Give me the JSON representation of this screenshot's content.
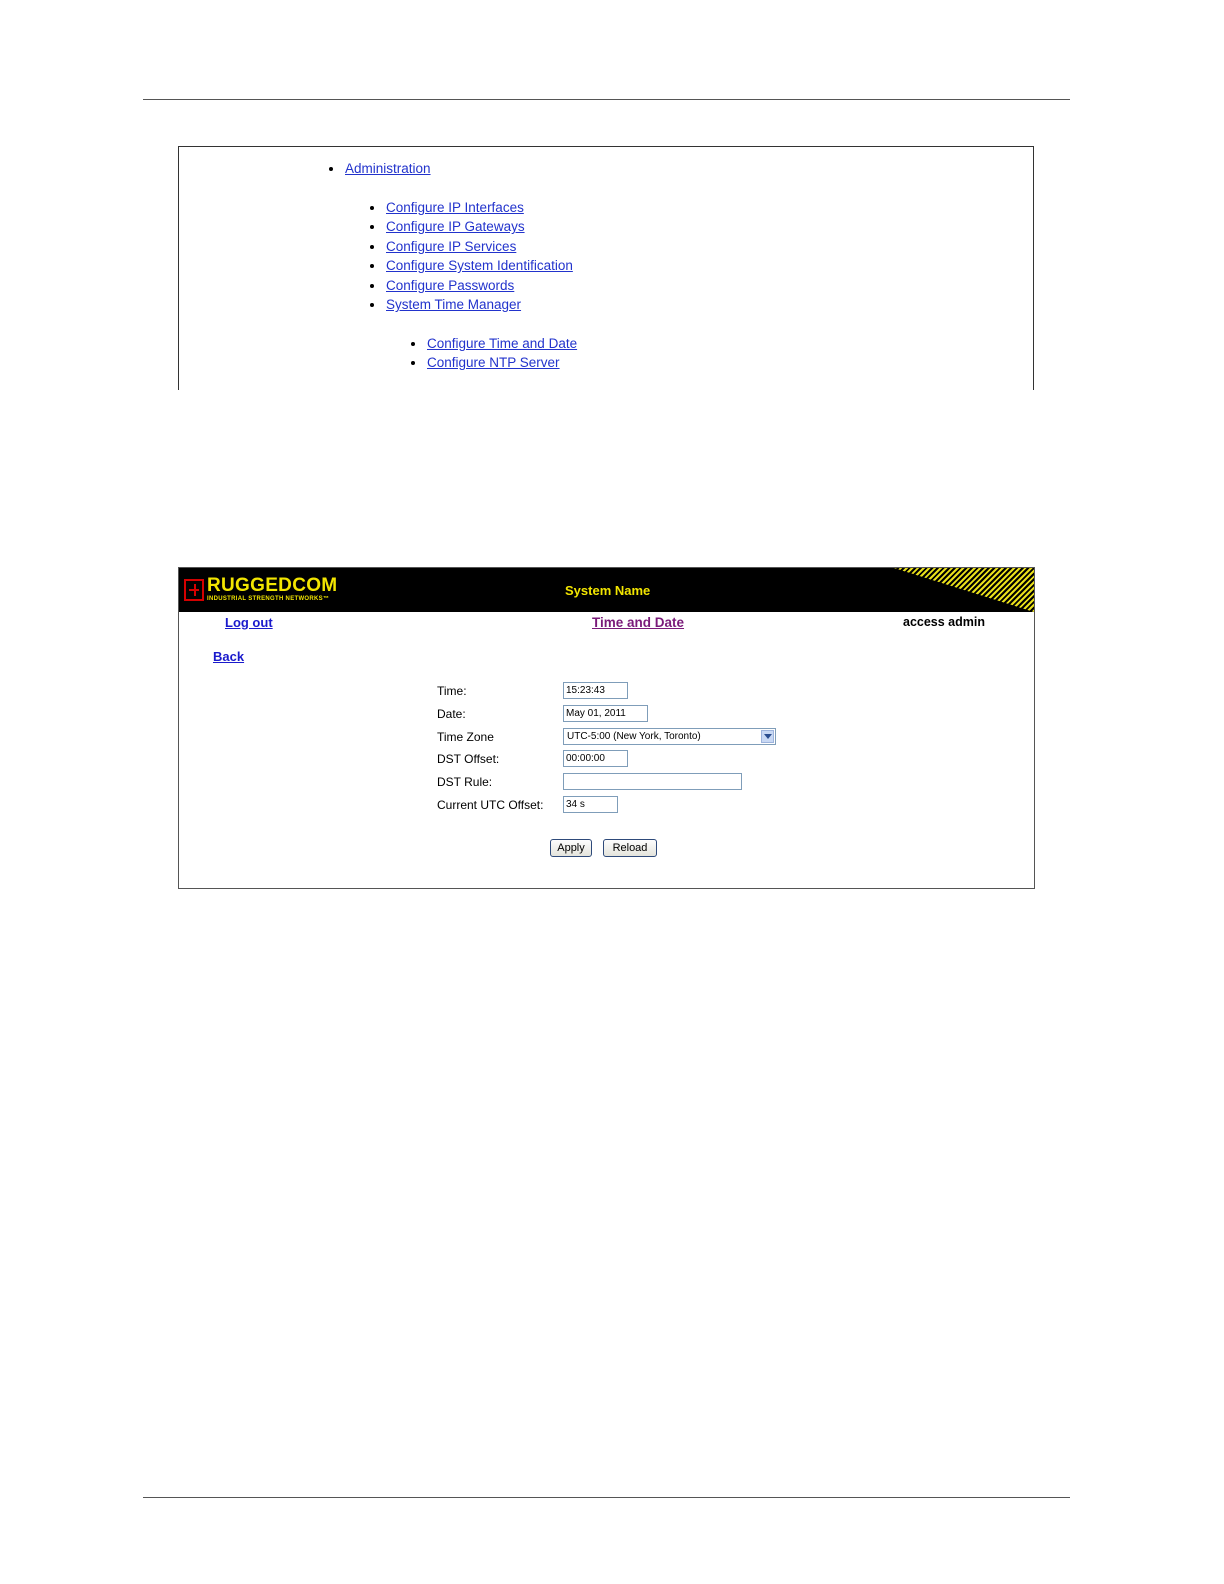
{
  "menu": {
    "administration": "Administration",
    "items": [
      "Configure IP Interfaces",
      "Configure IP Gateways",
      "Configure IP Services",
      "Configure System Identification",
      "Configure Passwords",
      "System Time Manager"
    ],
    "subitems": [
      "Configure Time and Date",
      "Configure NTP Server"
    ]
  },
  "app": {
    "logo_text": "RUGGEDCOM",
    "logo_tagline": "INDUSTRIAL STRENGTH NETWORKS™",
    "system_name": "System Name",
    "logout": "Log out",
    "page_title": "Time and Date",
    "access": "access admin",
    "back": "Back",
    "brand_colors": {
      "header_bg": "#000000",
      "logo_yellow": "#f2e500",
      "logo_red": "#d30000"
    }
  },
  "form": {
    "time_label": "Time:",
    "time_value": "15:23:43",
    "date_label": "Date:",
    "date_value": "May 01, 2011",
    "timezone_label": "Time Zone",
    "timezone_value": "UTC-5:00 (New York, Toronto)",
    "dst_offset_label": "DST Offset:",
    "dst_offset_value": "00:00:00",
    "dst_rule_label": "DST Rule:",
    "dst_rule_value": "",
    "utc_offset_label": "Current UTC Offset:",
    "utc_offset_value": "34 s",
    "apply": "Apply",
    "reload": "Reload"
  }
}
